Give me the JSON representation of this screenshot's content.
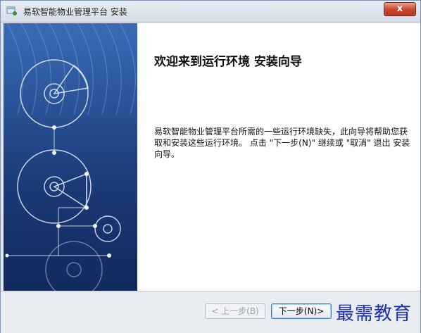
{
  "window": {
    "title": "易软智能物业管理平台 安装",
    "close_label": "x"
  },
  "content": {
    "heading": "欢迎来到运行环境 安装向导",
    "description": "易软智能物业管理平台所需的一些运行环境缺失，此向导将帮助您获取和安装这些运行环境。 点击 \"下一步(N)\" 继续或 \"取消\" 退出 安装向导。"
  },
  "buttons": {
    "back_label": "< 上一步(B)",
    "back_enabled": false,
    "next_label": "下一步(N)>"
  },
  "watermark": {
    "text": "最需教育"
  },
  "icons": {
    "app": "installer-icon",
    "close": "close-icon"
  },
  "colors": {
    "close_button": "#c7442c",
    "banner_top": "#3a6cb6",
    "banner_bottom": "#122a5e",
    "watermark": "#1c2fb8"
  }
}
